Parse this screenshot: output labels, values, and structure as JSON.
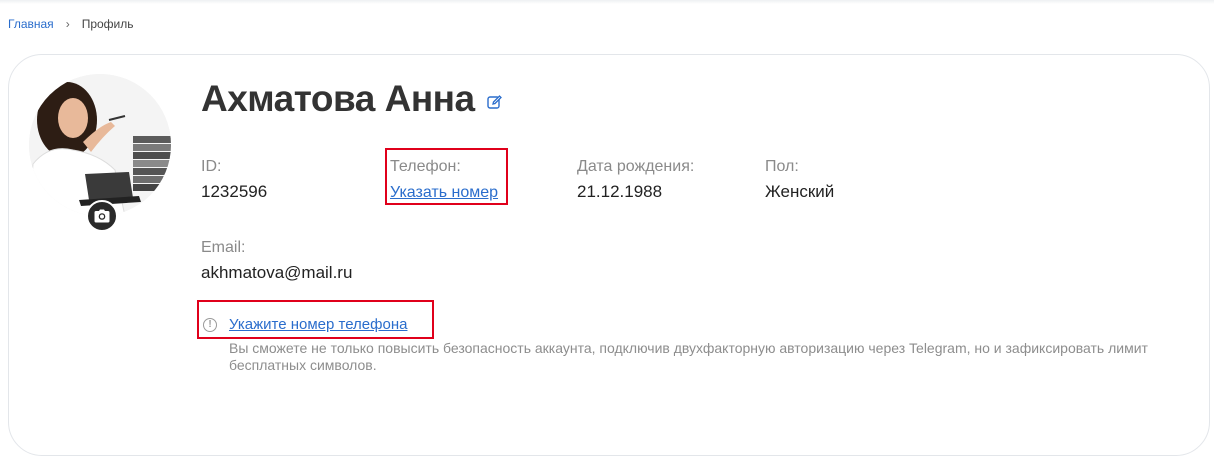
{
  "breadcrumb": {
    "home": "Главная",
    "separator": "›",
    "current": "Профиль"
  },
  "profile": {
    "name": "Ахматова Анна",
    "fields": {
      "id": {
        "label": "ID:",
        "value": "1232596"
      },
      "phone": {
        "label": "Телефон:",
        "link": "Указать номер"
      },
      "birth": {
        "label": "Дата рождения:",
        "value": "21.12.1988"
      },
      "gender": {
        "label": "Пол:",
        "value": "Женский"
      },
      "email": {
        "label": "Email:",
        "value": "akhmatova@mail.ru"
      }
    },
    "phone_prompt": {
      "icon": "!",
      "link": "Укажите номер телефона",
      "hint": "Вы сможете не только повысить безопасность аккаунта, подключив двухфакторную авторизацию через Telegram, но и зафиксировать лимит бесплатных символов."
    }
  },
  "icons": {
    "edit": "edit-pencil-icon",
    "camera": "camera-icon",
    "warning": "exclamation-circle-icon"
  },
  "colors": {
    "link": "#2a6dcc",
    "highlight": "#e0001b",
    "label": "#8a8a8a"
  }
}
